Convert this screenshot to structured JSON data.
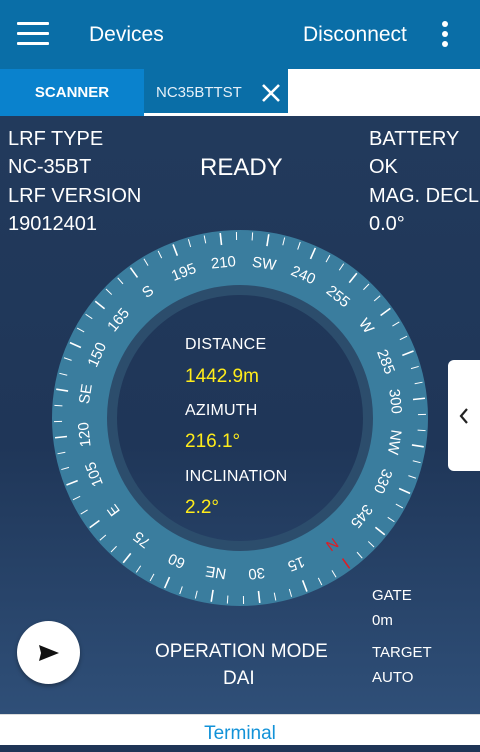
{
  "appbar": {
    "title": "Devices",
    "disconnect_label": "Disconnect"
  },
  "tabs": {
    "scanner": "SCANNER",
    "device": "NC35BTTST"
  },
  "status": "READY",
  "info_left": {
    "lrf_type_label": "LRF TYPE",
    "lrf_type_value": "NC-35BT",
    "lrf_version_label": "LRF VERSION",
    "lrf_version_value": "19012401"
  },
  "info_right": {
    "battery_label": "BATTERY",
    "battery_value": "OK",
    "mag_decl_label": "MAG. DECL",
    "mag_decl_value": "0.0°"
  },
  "measurements": {
    "distance_label": "DISTANCE",
    "distance_value": "1442.9m",
    "azimuth_label": "AZIMUTH",
    "azimuth_value": "216.1°",
    "inclination_label": "INCLINATION",
    "inclination_value": "2.2°"
  },
  "compass": {
    "heading_deg": 216.1,
    "north_color": "#e01b24",
    "labels": [
      "N",
      "15",
      "30",
      "NE",
      "60",
      "75",
      "E",
      "105",
      "120",
      "SE",
      "150",
      "165",
      "S",
      "195",
      "210",
      "SW",
      "240",
      "255",
      "W",
      "285",
      "300",
      "NW",
      "330",
      "345"
    ]
  },
  "operation": {
    "mode_label": "OPERATION MODE",
    "mode_value": "DAI"
  },
  "gate": {
    "label": "GATE",
    "value": "0m"
  },
  "target": {
    "label": "TARGET",
    "value": "AUTO"
  },
  "bottom": {
    "terminal_label": "Terminal"
  },
  "colors": {
    "appbar": "#0a6ea7",
    "scanner_tab": "#0a82cd",
    "accent_value": "#ffec1a",
    "dial_ring": "#3a7d9e"
  }
}
